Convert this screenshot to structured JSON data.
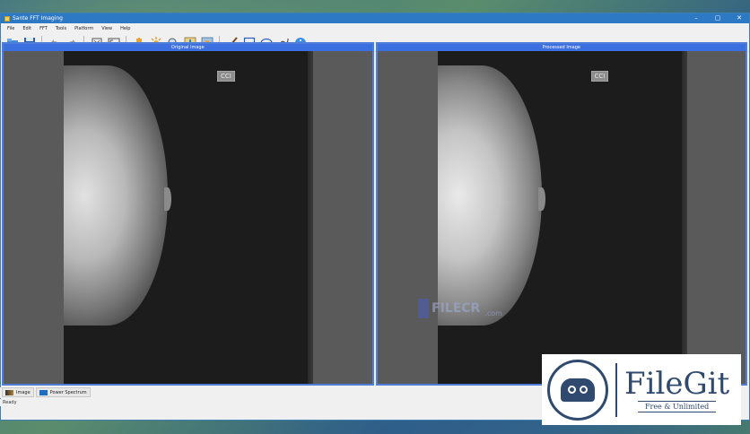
{
  "window": {
    "title": "Sante FFT Imaging",
    "controls": {
      "minimize": "–",
      "maximize": "▢",
      "close": "✕"
    }
  },
  "menu": {
    "items": [
      "File",
      "Edit",
      "FFT",
      "Tools",
      "Platform",
      "View",
      "Help"
    ]
  },
  "toolbar": {
    "icons": [
      "open-icon",
      "save-icon",
      "undo-icon",
      "redo-icon",
      "fit-icon",
      "fullscreen-icon",
      "hand-icon",
      "brightness-icon",
      "zoom-icon",
      "histogram-icon",
      "layers-icon",
      "brush-icon",
      "rectangle-icon",
      "ellipse-icon",
      "freehand-icon",
      "info-icon"
    ]
  },
  "panes": {
    "original": {
      "title": "Original Image",
      "marker": "CCI"
    },
    "processed": {
      "title": "Processed Image",
      "marker": "CCI"
    }
  },
  "bottom_tabs": [
    {
      "label": "Image"
    },
    {
      "label": "Power Spectrum"
    }
  ],
  "status": {
    "text": "Ready"
  },
  "watermark": {
    "name": "FILECR",
    "suffix": ".com"
  },
  "filegit": {
    "name": "FileGit",
    "tagline": "Free & Unlimited"
  },
  "colors": {
    "titlebar": "#2e79c4",
    "pane_header": "#3c6fe0",
    "pane_border": "#4f7ed9",
    "filegit": "#2f4a6e"
  }
}
